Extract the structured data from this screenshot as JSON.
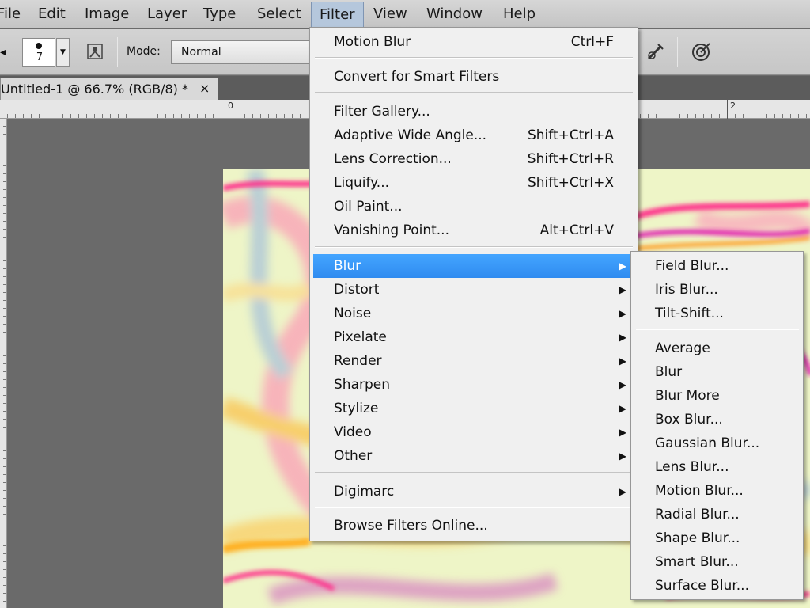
{
  "menubar": {
    "items": [
      "File",
      "Edit",
      "Image",
      "Layer",
      "Type",
      "Select",
      "Filter",
      "View",
      "Window",
      "Help"
    ],
    "active": "Filter"
  },
  "options": {
    "brush_size": "7",
    "mode_label": "Mode:",
    "mode_value": "Normal"
  },
  "document": {
    "tab_title": "Untitled-1 @ 66.7% (RGB/8) *",
    "close_glyph": "×"
  },
  "ruler": {
    "labels": [
      "0",
      "2"
    ]
  },
  "filter_menu": {
    "last_filter": {
      "label": "Motion Blur",
      "shortcut": "Ctrl+F"
    },
    "convert": {
      "label": "Convert for Smart Filters"
    },
    "gallery": [
      {
        "label": "Filter Gallery...",
        "shortcut": ""
      },
      {
        "label": "Adaptive Wide Angle...",
        "shortcut": "Shift+Ctrl+A"
      },
      {
        "label": "Lens Correction...",
        "shortcut": "Shift+Ctrl+R"
      },
      {
        "label": "Liquify...",
        "shortcut": "Shift+Ctrl+X"
      },
      {
        "label": "Oil Paint...",
        "shortcut": ""
      },
      {
        "label": "Vanishing Point...",
        "shortcut": "Alt+Ctrl+V"
      }
    ],
    "submenus": [
      "Blur",
      "Distort",
      "Noise",
      "Pixelate",
      "Render",
      "Sharpen",
      "Stylize",
      "Video",
      "Other"
    ],
    "highlighted": "Blur",
    "digimarc": "Digimarc",
    "browse": "Browse Filters Online...",
    "arrow_glyph": "▶"
  },
  "blur_submenu": {
    "gallery_items": [
      "Field Blur...",
      "Iris Blur...",
      "Tilt-Shift..."
    ],
    "items": [
      "Average",
      "Blur",
      "Blur More",
      "Box Blur...",
      "Gaussian Blur...",
      "Lens Blur...",
      "Motion Blur...",
      "Radial Blur...",
      "Shape Blur...",
      "Smart Blur...",
      "Surface Blur..."
    ]
  },
  "colors": {
    "highlight": "#3399ff",
    "canvas_bg": "#eef5c7",
    "stroke_pink": "#ff2e8a",
    "stroke_magenta": "#e01fb0",
    "stroke_orange": "#ffb020",
    "stroke_blue": "#8fb0e0"
  }
}
